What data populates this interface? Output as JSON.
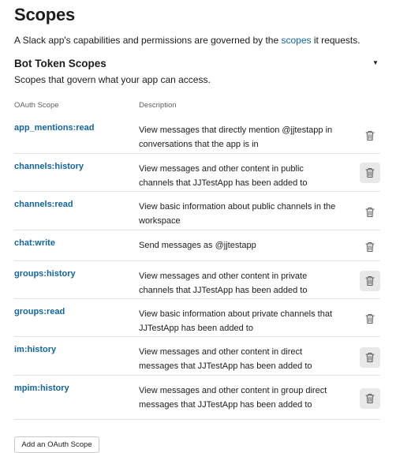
{
  "page": {
    "title": "Scopes",
    "intro_before": "A Slack app's capabilities and permissions are governed by the ",
    "intro_link": "scopes",
    "intro_after": " it requests."
  },
  "section": {
    "title": "Bot Token Scopes",
    "subtitle": "Scopes that govern what your app can access.",
    "caret": "▼"
  },
  "table": {
    "headers": {
      "scope": "OAuth Scope",
      "description": "Description"
    },
    "rows": [
      {
        "scope": "app_mentions:read",
        "description": "View messages that directly mention @jjtestapp in conversations that the app is in",
        "trash_highlighted": false
      },
      {
        "scope": "channels:history",
        "description": "View messages and other content in public channels that JJTestApp has been added to",
        "trash_highlighted": true
      },
      {
        "scope": "channels:read",
        "description": "View basic information about public channels in the workspace",
        "trash_highlighted": false
      },
      {
        "scope": "chat:write",
        "description": "Send messages as @jjtestapp",
        "trash_highlighted": false
      },
      {
        "scope": "groups:history",
        "description": "View messages and other content in private channels that JJTestApp has been added to",
        "trash_highlighted": true
      },
      {
        "scope": "groups:read",
        "description": "View basic information about private channels that JJTestApp has been added to",
        "trash_highlighted": false
      },
      {
        "scope": "im:history",
        "description": "View messages and other content in direct messages that JJTestApp has been added to",
        "trash_highlighted": true
      },
      {
        "scope": "mpim:history",
        "description": "View messages and other content in group direct messages that JJTestApp has been added to",
        "trash_highlighted": true
      }
    ],
    "row_action_icon": "trash-icon"
  },
  "add_button_label": "Add an OAuth Scope",
  "colors": {
    "link": "#1264a3",
    "text": "#1d1c1d",
    "muted": "#616061",
    "divider": "#e2e2e2"
  }
}
